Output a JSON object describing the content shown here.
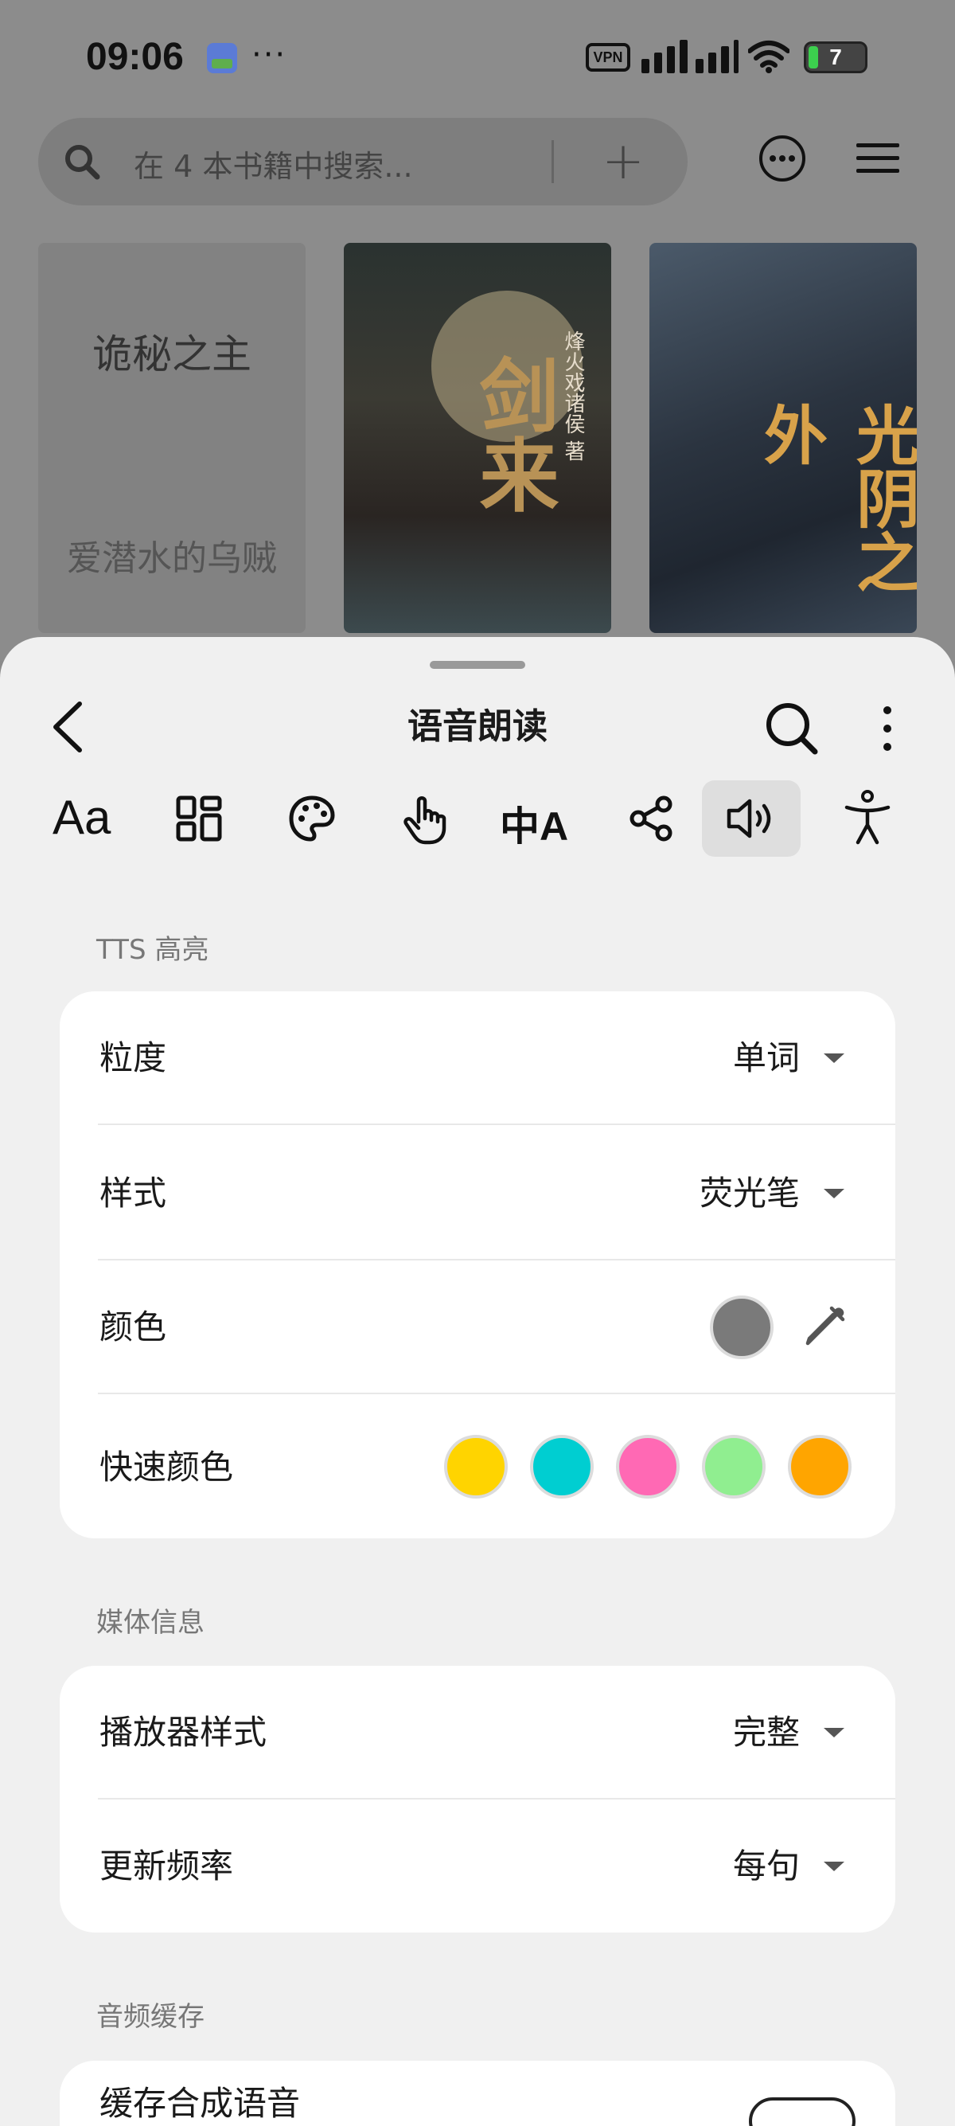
{
  "status_bar": {
    "time": "09:06",
    "more_glyph": "···",
    "vpn_label": "VPN",
    "battery_level": "7",
    "icons": [
      "app-notification-icon",
      "signal-icon",
      "wifi-icon",
      "battery-charging-icon"
    ]
  },
  "library": {
    "search_placeholder": "在 4 本书籍中搜索...",
    "add_glyph": "+",
    "books": [
      {
        "title": "诡秘之主",
        "author": "爱潜水的乌贼"
      },
      {
        "title": "剑来",
        "author": "烽火戏诸侯 著"
      },
      {
        "title": "光阴之外"
      }
    ]
  },
  "sheet": {
    "title": "语音朗读",
    "toolbar": [
      {
        "name": "font-icon",
        "glyph": "Aa"
      },
      {
        "name": "layout-icon"
      },
      {
        "name": "palette-icon"
      },
      {
        "name": "touch-icon"
      },
      {
        "name": "translate-icon",
        "glyph": "中A"
      },
      {
        "name": "share-icon"
      },
      {
        "name": "speaker-icon",
        "active": true
      },
      {
        "name": "accessibility-icon"
      }
    ],
    "tts_section": {
      "label": "TTS 高亮",
      "granularity": {
        "label": "粒度",
        "value": "单词"
      },
      "style": {
        "label": "样式",
        "value": "荧光笔"
      },
      "color": {
        "label": "颜色",
        "value_color": "#7a7a7a"
      },
      "quick_colors": {
        "label": "快速颜色",
        "swatches": [
          "#FFD400",
          "#00CED1",
          "#FF69B4",
          "#90EE90",
          "#FFA500"
        ]
      }
    },
    "media_section": {
      "label": "媒体信息",
      "player_style": {
        "label": "播放器样式",
        "value": "完整"
      },
      "update_frequency": {
        "label": "更新频率",
        "value": "每句"
      }
    },
    "audio_cache_section": {
      "label": "音频缓存",
      "cache_synth": {
        "label": "缓存合成语音"
      }
    }
  }
}
